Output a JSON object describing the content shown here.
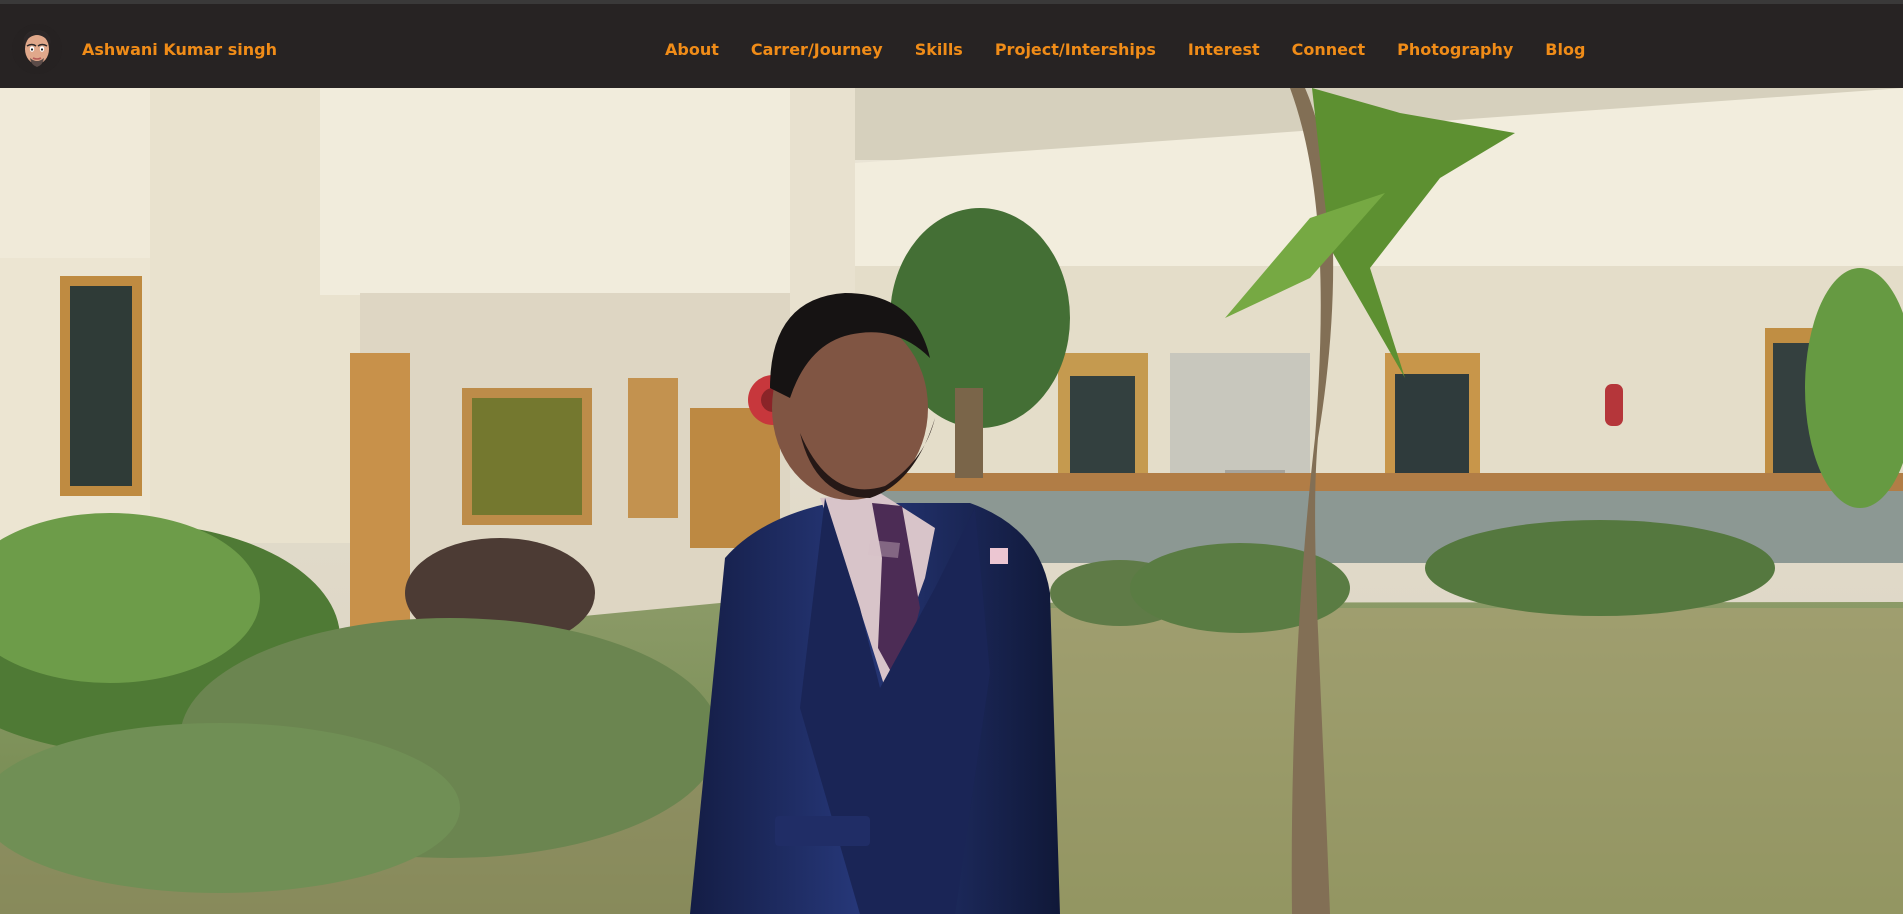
{
  "header": {
    "brand_name": "Ashwani Kumar singh",
    "avatar_icon": "person-avatar-icon"
  },
  "nav": {
    "items": [
      {
        "label": "About"
      },
      {
        "label": "Carrer/Journey"
      },
      {
        "label": "Skills"
      },
      {
        "label": "Project/Interships"
      },
      {
        "label": "Interest"
      },
      {
        "label": "Connect"
      },
      {
        "label": "Photography"
      },
      {
        "label": "Blog"
      }
    ]
  },
  "theme": {
    "nav_background": "#272323",
    "accent": "#f08c18"
  }
}
